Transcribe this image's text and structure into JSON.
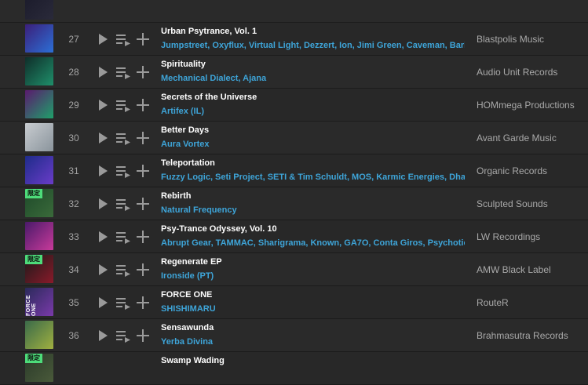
{
  "tracks": [
    {
      "num": "",
      "title": "",
      "artists": "",
      "label": "",
      "badge": "",
      "vtext": "",
      "art": [
        "#1a1a2a",
        "#2a2a3a"
      ]
    },
    {
      "num": "27",
      "title": "Urban Psytrance, Vol. 1",
      "artists": "Jumpstreet, Oxyflux, Virtual Light, Dezzert, Ion, Jimi Green, Caveman, Barket, Z",
      "label": "Blastpolis Music",
      "badge": "",
      "vtext": "",
      "art": [
        "#3b1f7a",
        "#2c6fd6"
      ]
    },
    {
      "num": "28",
      "title": "Spirituality",
      "artists": "Mechanical Dialect, Ajana",
      "label": "Audio Unit Records",
      "badge": "",
      "vtext": "",
      "art": [
        "#0f2e2a",
        "#1f8f6a"
      ]
    },
    {
      "num": "29",
      "title": "Secrets of the Universe",
      "artists": "Artifex (IL)",
      "label": "HOMmega Productions",
      "badge": "",
      "vtext": "",
      "art": [
        "#5a1a6e",
        "#1fa06a"
      ]
    },
    {
      "num": "30",
      "title": "Better Days",
      "artists": "Aura Vortex",
      "label": "Avant Garde Music",
      "badge": "",
      "vtext": "",
      "art": [
        "#c8ccd0",
        "#8a949c"
      ]
    },
    {
      "num": "31",
      "title": "Teleportation",
      "artists": "Fuzzy Logic, Seti Project, SETI & Tim Schuldt, MOS, Karmic Energies, Dharma",
      "label": "Organic Records",
      "badge": "",
      "vtext": "",
      "art": [
        "#1e2c8a",
        "#6a3cc8"
      ]
    },
    {
      "num": "32",
      "title": "Rebirth",
      "artists": "Natural Frequency",
      "label": "Sculpted Sounds",
      "badge": "限定",
      "vtext": "",
      "art": [
        "#1e4a2a",
        "#3a6a3a"
      ]
    },
    {
      "num": "33",
      "title": "Psy-Trance Odyssey, Vol. 10",
      "artists": "Abrupt Gear, TAMMAC, Sharigrama, Known, GA7O, Conta Giros, Psychotic Ste",
      "label": "LW Recordings",
      "badge": "",
      "vtext": "",
      "art": [
        "#4a1a6a",
        "#c83a9a"
      ]
    },
    {
      "num": "34",
      "title": "Regenerate EP",
      "artists": "Ironside (PT)",
      "label": "AMW Black Label",
      "badge": "限定",
      "vtext": "",
      "art": [
        "#1a1a1a",
        "#8a1a2a"
      ]
    },
    {
      "num": "35",
      "title": "FORCE ONE",
      "artists": "SHISHIMARU",
      "label": "RouteR",
      "badge": "",
      "vtext": "FORCE ONE",
      "art": [
        "#2a2a5a",
        "#7a3aaa"
      ]
    },
    {
      "num": "36",
      "title": "Sensawunda",
      "artists": "Yerba Divina",
      "label": "Brahmasutra Records",
      "badge": "",
      "vtext": "",
      "art": [
        "#3a6a4a",
        "#a0b040"
      ]
    },
    {
      "num": "",
      "title": "Swamp Wading",
      "artists": "",
      "label": "",
      "badge": "限定",
      "vtext": "",
      "art": [
        "#2a3a2a",
        "#4a5a3a"
      ]
    }
  ],
  "icons": {
    "play": "play-icon",
    "queue": "add-to-queue-icon",
    "add": "add-to-playlist-icon"
  }
}
